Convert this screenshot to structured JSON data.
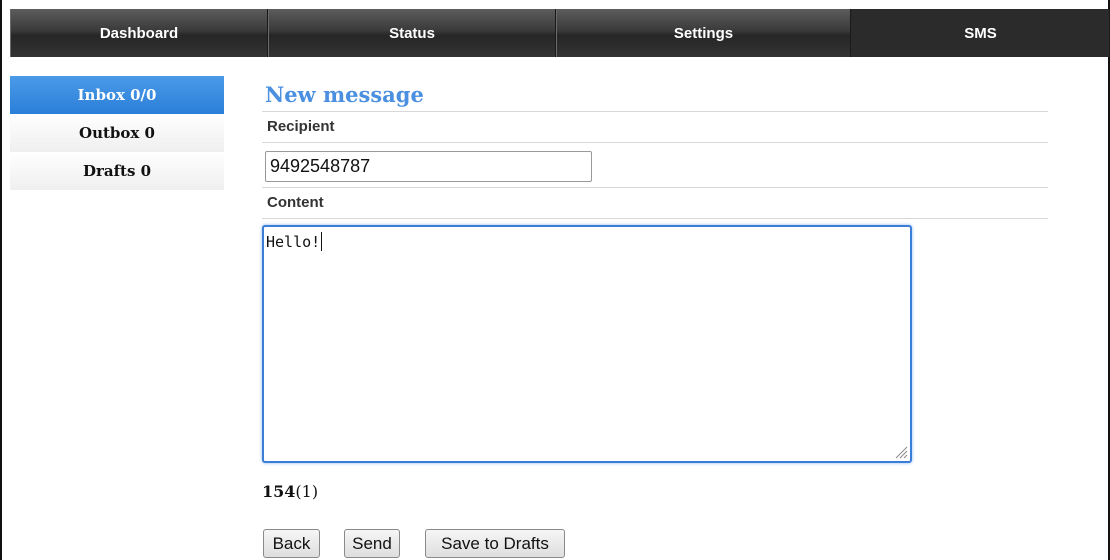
{
  "nav": {
    "tabs": [
      {
        "label": "Dashboard"
      },
      {
        "label": "Status"
      },
      {
        "label": "Settings"
      },
      {
        "label": "SMS",
        "active": true
      }
    ]
  },
  "sidebar": {
    "items": [
      {
        "label": "Inbox 0/0",
        "active": true
      },
      {
        "label": "Outbox 0"
      },
      {
        "label": "Drafts 0"
      }
    ]
  },
  "form": {
    "title": "New message",
    "recipient_label": "Recipient",
    "recipient_value": "9492548787",
    "content_label": "Content",
    "content_value": "Hello!",
    "counter_remaining": "154",
    "counter_parts": "(1)"
  },
  "actions": {
    "back_label": "Back",
    "send_label": "Send",
    "drafts_label": "Save to Drafts"
  },
  "colors": {
    "accent": "#4a8fe0",
    "nav_bg": "#333333",
    "active_side": "#2b7fd8"
  }
}
